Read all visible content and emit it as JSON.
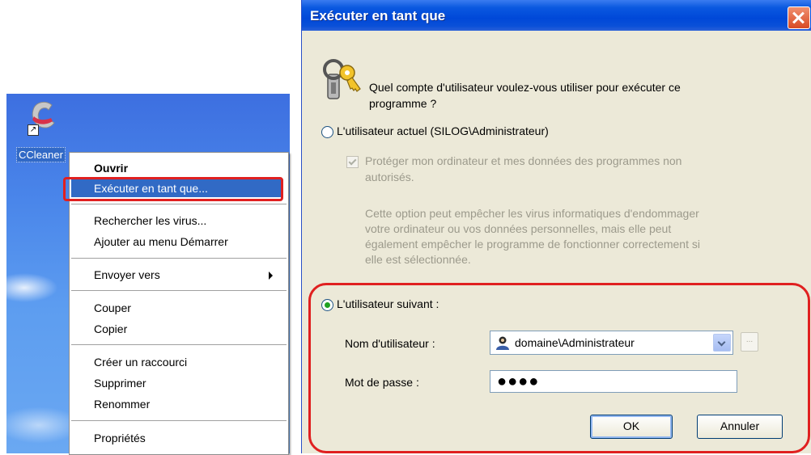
{
  "desktop": {
    "shortcut_label": "CCleaner",
    "shortcut_arrow": "↗"
  },
  "context_menu": {
    "items": [
      {
        "label": "Ouvrir",
        "bold": true
      },
      {
        "label": "Exécuter en tant que...",
        "highlighted": true
      },
      {
        "label": "Rechercher les virus..."
      },
      {
        "label": "Ajouter au menu Démarrer"
      },
      {
        "label": "Envoyer vers",
        "submenu": true
      },
      {
        "label": "Couper"
      },
      {
        "label": "Copier"
      },
      {
        "label": "Créer un raccourci"
      },
      {
        "label": "Supprimer"
      },
      {
        "label": "Renommer"
      },
      {
        "label": "Propriétés"
      }
    ]
  },
  "dialog": {
    "title": "Exécuter en tant que",
    "question": "Quel compte d'utilisateur voulez-vous utiliser pour exécuter ce programme ?",
    "question_line1": "Quel compte d'utilisateur voulez-vous utiliser pour exécuter ce",
    "question_line2": "programme ?",
    "current_user_option": "L'utilisateur actuel (SILOG\\Administrateur)",
    "protect_checkbox_line1": "Protéger mon ordinateur et mes données des programmes non",
    "protect_checkbox_line2": "autorisés.",
    "protect_description_lines": [
      "Cette option peut empêcher les virus informatiques d'endommager",
      "votre ordinateur ou vos données personnelles, mais elle peut",
      "également empêcher le programme de fonctionner correctement si",
      "elle est sélectionnée."
    ],
    "following_user_option": "L'utilisateur suivant :",
    "username_label": "Nom d'utilisateur :",
    "username_value": "domaine\\Administrateur",
    "password_label": "Mot de passe :",
    "password_value": "●●●●",
    "browse_label": "...",
    "ok_label": "OK",
    "cancel_label": "Annuler"
  },
  "colors": {
    "highlight_red": "#e02020",
    "menu_selection": "#316ac5",
    "title_bar": "#0a58e0",
    "dialog_bg": "#ece9d8"
  }
}
